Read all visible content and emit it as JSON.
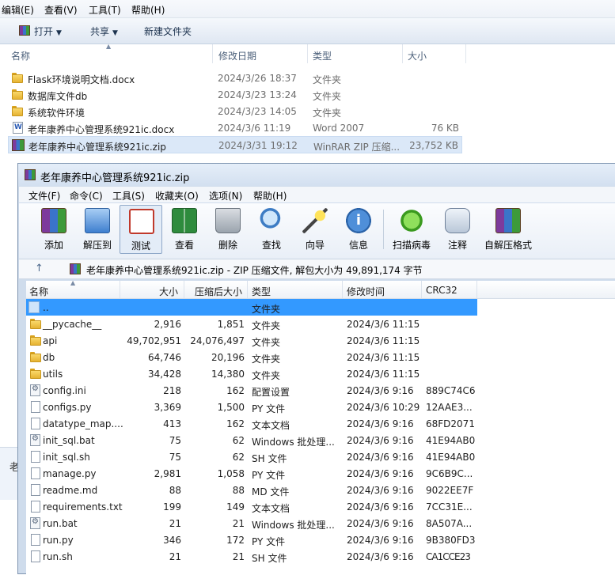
{
  "explorer": {
    "menu": [
      "编辑(E)",
      "查看(V)",
      "工具(T)",
      "帮助(H)"
    ],
    "toolbar": {
      "open": "打开",
      "share": "共享",
      "new_folder": "新建文件夹"
    },
    "columns": {
      "name": "名称",
      "date": "修改日期",
      "type": "类型",
      "size": "大小"
    },
    "rows": [
      {
        "name": "Flask环境说明文档.docx",
        "date": "2024/3/26 18:37",
        "type": "文件夹",
        "size": "",
        "icon": "folder-icon"
      },
      {
        "name": "数据库文件db",
        "date": "2024/3/23 13:24",
        "type": "文件夹",
        "size": "",
        "icon": "folder-icon"
      },
      {
        "name": "系统软件环境",
        "date": "2024/3/23 14:05",
        "type": "文件夹",
        "size": "",
        "icon": "folder-icon"
      },
      {
        "name": "老年康养中心管理系统921ic.docx",
        "date": "2024/3/6 11:19",
        "type": "Word 2007",
        "size": "76 KB",
        "icon": "word-doc-icon"
      },
      {
        "name": "老年康养中心管理系统921ic.zip",
        "date": "2024/3/31 19:12",
        "type": "WinRAR ZIP 压缩...",
        "size": "23,752 KB",
        "icon": "zip-archive-icon"
      }
    ],
    "detail_partial": "老"
  },
  "winrar": {
    "title": "老年康养中心管理系统921ic.zip",
    "menu": [
      "文件(F)",
      "命令(C)",
      "工具(S)",
      "收藏夹(O)",
      "选项(N)",
      "帮助(H)"
    ],
    "toolbar": [
      "添加",
      "解压到",
      "测试",
      "查看",
      "删除",
      "查找",
      "向导",
      "信息",
      "扫描病毒",
      "注释",
      "自解压格式"
    ],
    "address": "老年康养中心管理系统921ic.zip - ZIP 压缩文件, 解包大小为 49,891,174 字节",
    "columns": {
      "name": "名称",
      "size": "大小",
      "packed": "压缩后大小",
      "type": "类型",
      "modified": "修改时间",
      "crc": "CRC32"
    },
    "rows": [
      {
        "name": "..",
        "size": "",
        "packed": "",
        "type": "文件夹",
        "modified": "",
        "crc": ""
      },
      {
        "name": "__pycache__",
        "size": "2,916",
        "packed": "1,851",
        "type": "文件夹",
        "modified": "2024/3/6 11:15",
        "crc": ""
      },
      {
        "name": "api",
        "size": "49,702,951",
        "packed": "24,076,497",
        "type": "文件夹",
        "modified": "2024/3/6 11:15",
        "crc": ""
      },
      {
        "name": "db",
        "size": "64,746",
        "packed": "20,196",
        "type": "文件夹",
        "modified": "2024/3/6 11:15",
        "crc": ""
      },
      {
        "name": "utils",
        "size": "34,428",
        "packed": "14,380",
        "type": "文件夹",
        "modified": "2024/3/6 11:15",
        "crc": ""
      },
      {
        "name": "config.ini",
        "size": "218",
        "packed": "162",
        "type": "配置设置",
        "modified": "2024/3/6 9:16",
        "crc": "889C74C6"
      },
      {
        "name": "configs.py",
        "size": "3,369",
        "packed": "1,500",
        "type": "PY 文件",
        "modified": "2024/3/6 10:29",
        "crc": "12AAE3..."
      },
      {
        "name": "datatype_map....",
        "size": "413",
        "packed": "162",
        "type": "文本文档",
        "modified": "2024/3/6 9:16",
        "crc": "68FD2071"
      },
      {
        "name": "init_sql.bat",
        "size": "75",
        "packed": "62",
        "type": "Windows 批处理...",
        "modified": "2024/3/6 9:16",
        "crc": "41E94AB0"
      },
      {
        "name": "init_sql.sh",
        "size": "75",
        "packed": "62",
        "type": "SH 文件",
        "modified": "2024/3/6 9:16",
        "crc": "41E94AB0"
      },
      {
        "name": "manage.py",
        "size": "2,981",
        "packed": "1,058",
        "type": "PY 文件",
        "modified": "2024/3/6 9:16",
        "crc": "9C6B9C..."
      },
      {
        "name": "readme.md",
        "size": "88",
        "packed": "88",
        "type": "MD 文件",
        "modified": "2024/3/6 9:16",
        "crc": "9022EE7F"
      },
      {
        "name": "requirements.txt",
        "size": "199",
        "packed": "149",
        "type": "文本文档",
        "modified": "2024/3/6 9:16",
        "crc": "7CC31E..."
      },
      {
        "name": "run.bat",
        "size": "21",
        "packed": "21",
        "type": "Windows 批处理...",
        "modified": "2024/3/6 9:16",
        "crc": "8A507A..."
      },
      {
        "name": "run.py",
        "size": "346",
        "packed": "172",
        "type": "PY 文件",
        "modified": "2024/3/6 9:16",
        "crc": "9B380FD3"
      },
      {
        "name": "run.sh",
        "size": "21",
        "packed": "21",
        "type": "SH 文件",
        "modified": "2024/3/6 9:16",
        "crc": "CA1CCE23"
      }
    ]
  }
}
